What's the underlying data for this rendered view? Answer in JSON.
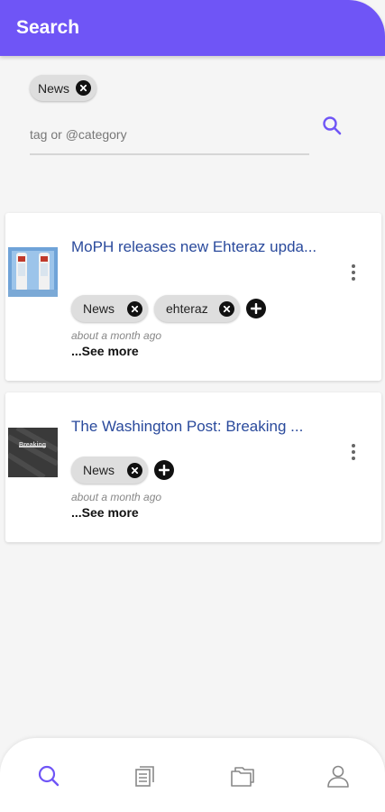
{
  "app_bar": {
    "title": "Search"
  },
  "search": {
    "chips": [
      "News"
    ],
    "placeholder": "tag or @category",
    "value": ""
  },
  "results": [
    {
      "title": "MoPH releases new Ehteraz upda...",
      "tags": [
        "News",
        "ehteraz"
      ],
      "time": "about a month ago",
      "see_more": "...See more"
    },
    {
      "title": "The Washington Post: Breaking ...",
      "tags": [
        "News"
      ],
      "thumb_text": "Breaking",
      "time": "about a month ago",
      "see_more": "...See more"
    }
  ],
  "bottom_nav": {
    "items": [
      "search-icon",
      "articles-icon",
      "collections-icon",
      "profile-icon"
    ],
    "active": "search-icon"
  },
  "colors": {
    "primary": "#6f55f6",
    "title_link": "#2a4a9c",
    "chip_bg": "#dedede"
  }
}
